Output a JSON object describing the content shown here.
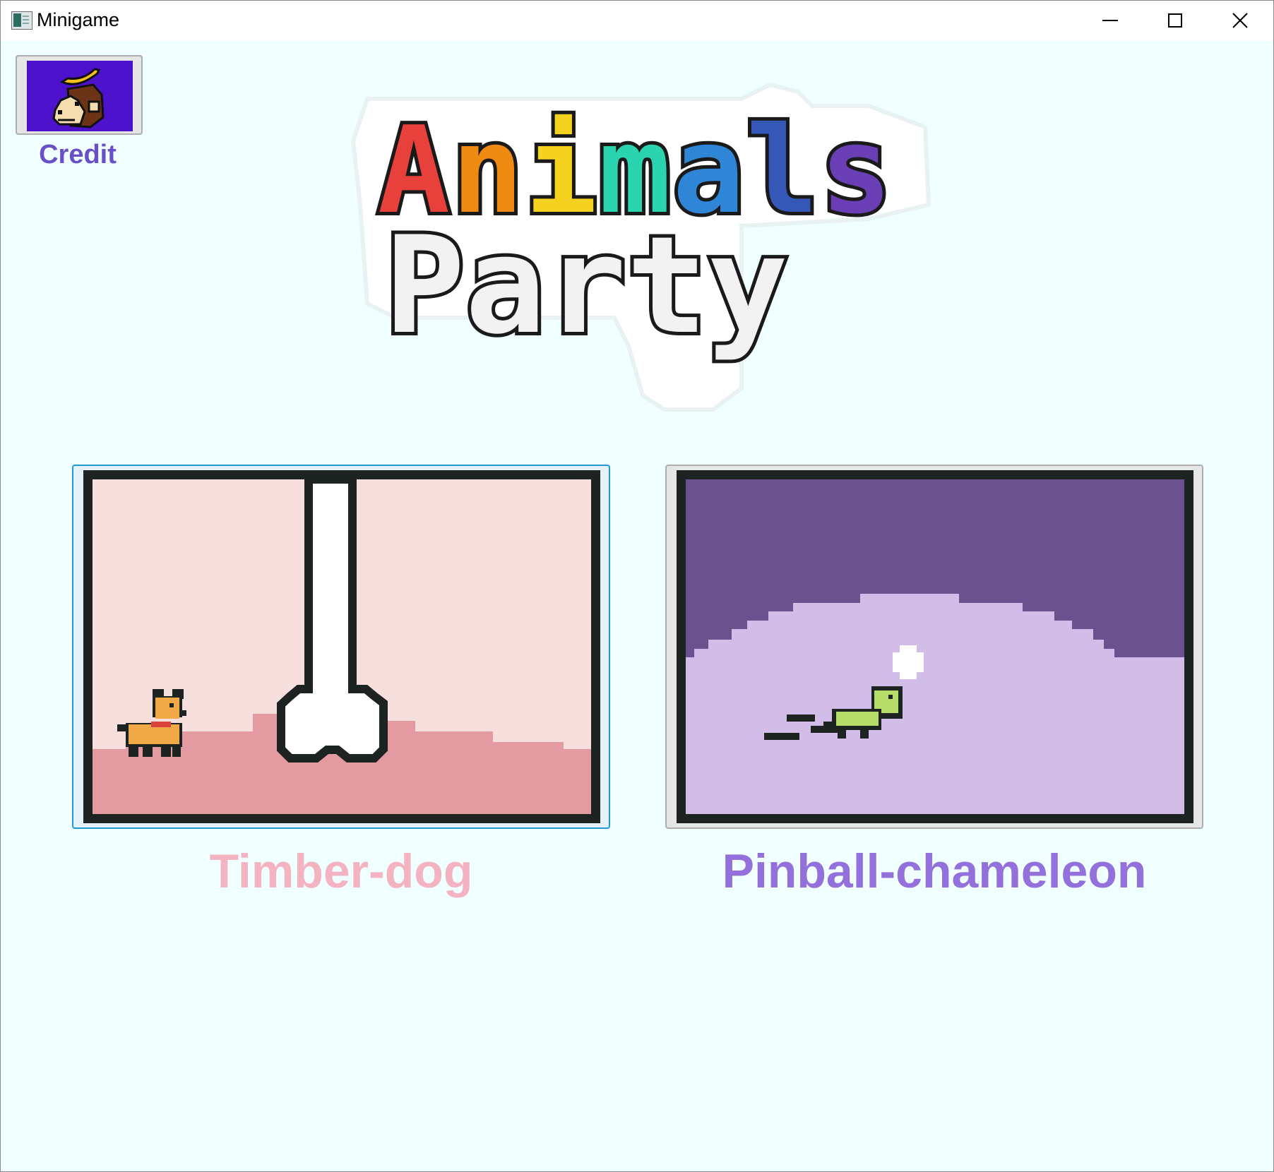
{
  "window": {
    "title": "Minigame",
    "controls": [
      "minimize",
      "maximize",
      "close"
    ]
  },
  "credit": {
    "label": "Credit",
    "icon": "monkey-with-banana-icon"
  },
  "logo": {
    "line1": "Animals",
    "line2": "Party",
    "line1_colors": [
      "#e8413c",
      "#ef8a13",
      "#f5d21f",
      "#29d4ae",
      "#2f86d6",
      "#3558b8",
      "#6a3fb6"
    ]
  },
  "games": [
    {
      "name": "Timber-dog",
      "label_color": "#f4b3c1",
      "selected": true
    },
    {
      "name": "Pinball-chameleon",
      "label_color": "#9370db",
      "selected": false
    }
  ]
}
